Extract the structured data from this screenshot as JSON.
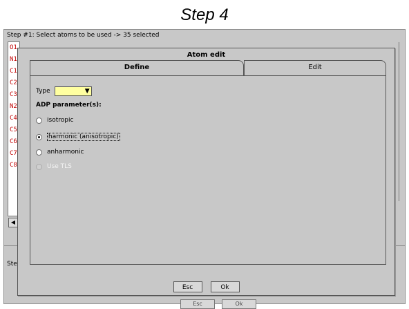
{
  "caption": "Step 4",
  "background_window": {
    "step_title": "Step #1: Select atoms to be used  -> 35 selected",
    "list_items": [
      "O1",
      "N1",
      "C1",
      "C2",
      "C3",
      "N2",
      "C4",
      "C5",
      "C6",
      "C7",
      "C8"
    ],
    "step2_label": "Ste|",
    "buttons": [
      "Esc",
      "Ok"
    ]
  },
  "dialog": {
    "title": "Atom edit",
    "tabs": [
      {
        "label": "Define",
        "active": true
      },
      {
        "label": "Edit",
        "active": false
      }
    ],
    "type_label": "Type",
    "type_value": "",
    "type_color": "#ffffa0",
    "adp_heading": "ADP parameter(s):",
    "options": [
      {
        "label": "isotropic",
        "selected": false,
        "enabled": true
      },
      {
        "label": "harmonic (anisotropic)",
        "selected": true,
        "enabled": true
      },
      {
        "label": "anharmonic",
        "selected": false,
        "enabled": true
      },
      {
        "label": "Use TLS",
        "selected": false,
        "enabled": false
      }
    ],
    "buttons": {
      "esc": "Esc",
      "ok": "Ok"
    }
  }
}
